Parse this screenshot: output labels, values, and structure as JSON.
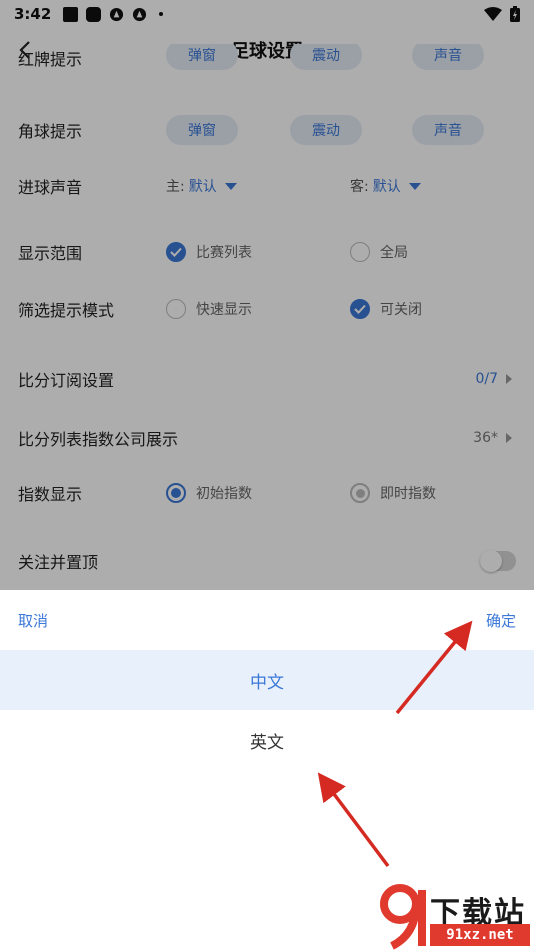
{
  "status_bar": {
    "time": "3:42"
  },
  "nav": {
    "title": "足球设置"
  },
  "rows": {
    "partial": {
      "label": "红牌提示",
      "chips": [
        "弹窗",
        "震动",
        "声音"
      ]
    },
    "corner": {
      "label": "角球提示",
      "chips": [
        "弹窗",
        "震动",
        "声音"
      ]
    },
    "goal_sound": {
      "label": "进球声音",
      "home_prefix": "主:",
      "home_value": "默认",
      "away_prefix": "客:",
      "away_value": "默认"
    },
    "display_range": {
      "label": "显示范围",
      "opt1": "比赛列表",
      "opt2": "全局"
    },
    "filter_mode": {
      "label": "筛选提示模式",
      "opt1": "快速显示",
      "opt2": "可关闭"
    },
    "score_sub": {
      "label": "比分订阅设置",
      "value": "0/7"
    },
    "index_company": {
      "label": "比分列表指数公司展示",
      "value": "36*"
    },
    "index_display": {
      "label": "指数显示",
      "opt1": "初始指数",
      "opt2": "即时指数"
    },
    "follow_top": {
      "label": "关注并置顶"
    }
  },
  "sheet": {
    "cancel": "取消",
    "confirm": "确定",
    "options": [
      "中文",
      "英文"
    ],
    "selected_index": 0
  },
  "watermark": {
    "text": "下载站",
    "url": "91xz.net"
  },
  "colors": {
    "accent": "#3b78d8",
    "arrow": "#d42a22",
    "chip_bg": "#e5ecf7"
  }
}
